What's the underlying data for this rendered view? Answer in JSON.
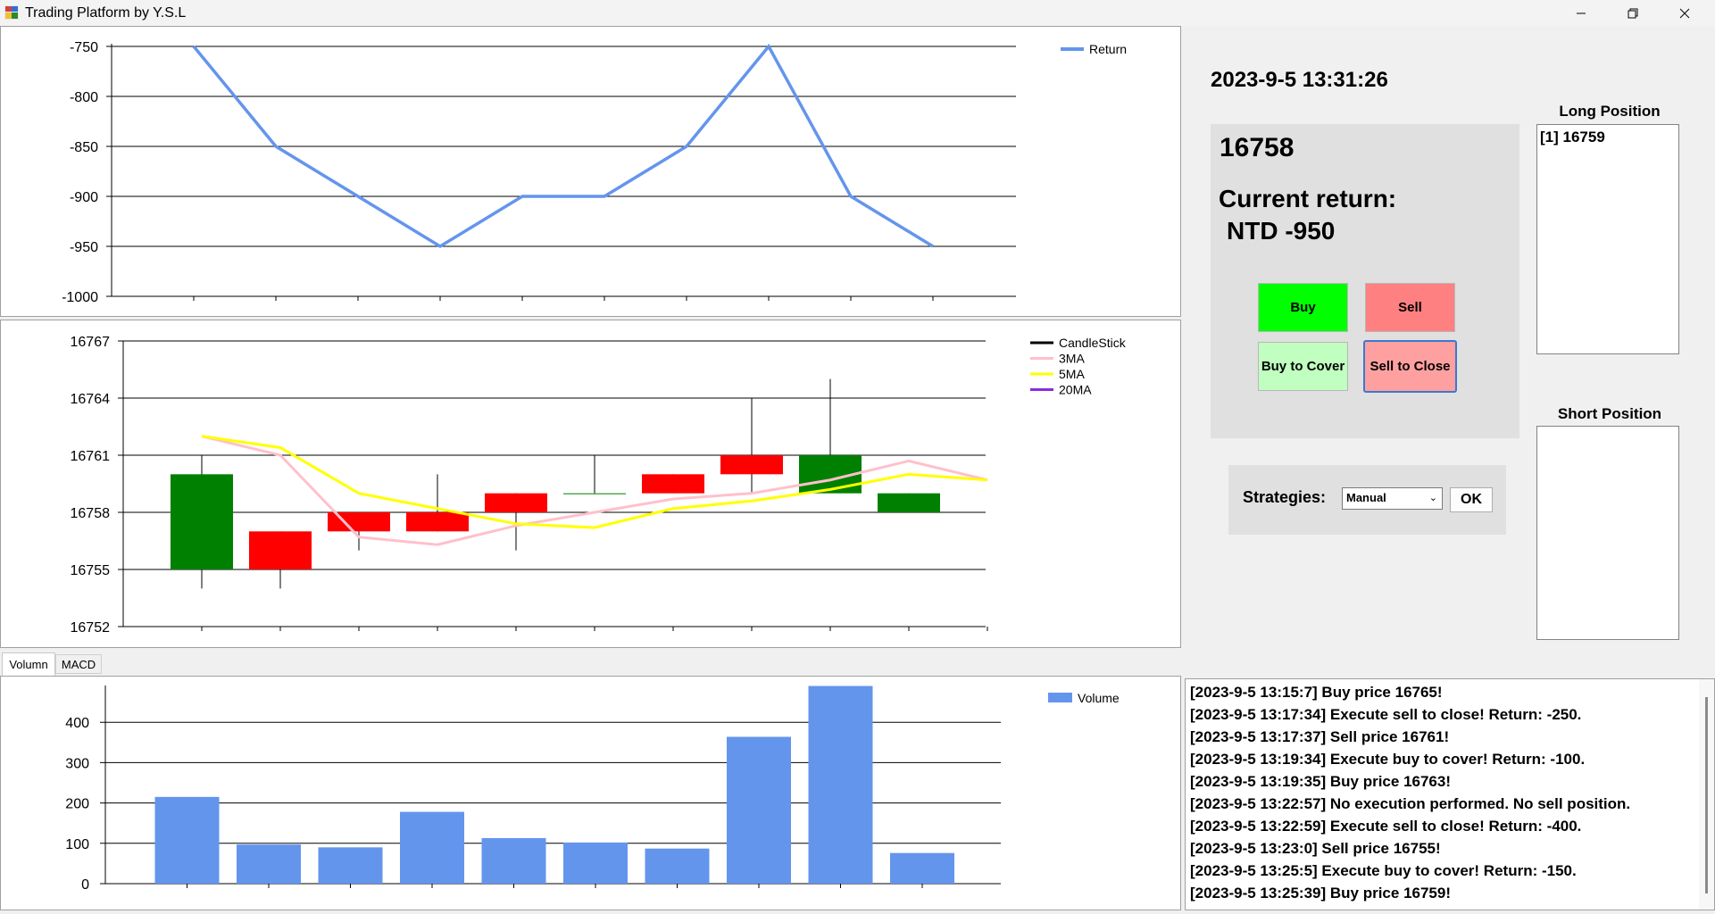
{
  "window": {
    "title": "Trading Platform by Y.S.L",
    "minimize_symbol": "—",
    "restore_symbol": "❐",
    "close_symbol": "✕"
  },
  "return_chart": {
    "legend": "Return",
    "y_ticks": [
      "-750",
      "-800",
      "-850",
      "-900",
      "-950",
      "-1000"
    ]
  },
  "candle_chart": {
    "legend": [
      "CandleStick",
      "3MA",
      "5MA",
      "20MA"
    ],
    "y_ticks": [
      "16767",
      "16764",
      "16761",
      "16758",
      "16755",
      "16752"
    ]
  },
  "bottom_tabs": [
    "Volumn",
    "MACD"
  ],
  "volume_chart": {
    "legend": "Volume",
    "y_ticks": [
      "400",
      "300",
      "200",
      "100",
      "0"
    ]
  },
  "chart_data": [
    {
      "type": "line",
      "title": "",
      "x": [
        1,
        2,
        3,
        4,
        5,
        6,
        7,
        8,
        9,
        10
      ],
      "series": [
        {
          "name": "Return",
          "values": [
            -750,
            -850,
            -900,
            -950,
            -900,
            -900,
            -850,
            -750,
            -900,
            -950
          ],
          "color": "#6495ed"
        }
      ],
      "ylim": [
        -1000,
        -750
      ],
      "grid": true,
      "legend_position": "top-right"
    },
    {
      "type": "candlestick",
      "title": "",
      "x": [
        1,
        2,
        3,
        4,
        5,
        6,
        7,
        8,
        9,
        10,
        11
      ],
      "candles": [
        {
          "open": 16755,
          "close": 16760,
          "high": 16761,
          "low": 16754
        },
        {
          "open": 16757,
          "close": 16755,
          "high": 16757,
          "low": 16754
        },
        {
          "open": 16758,
          "close": 16757,
          "high": 16758,
          "low": 16756
        },
        {
          "open": 16758,
          "close": 16757,
          "high": 16760,
          "low": 16757
        },
        {
          "open": 16759,
          "close": 16758,
          "high": 16759,
          "low": 16756
        },
        {
          "open": 16759,
          "close": 16759,
          "high": 16761,
          "low": 16759
        },
        {
          "open": 16760,
          "close": 16759,
          "high": 16760,
          "low": 16759
        },
        {
          "open": 16761,
          "close": 16760,
          "high": 16764,
          "low": 16759
        },
        {
          "open": 16759,
          "close": 16761,
          "high": 16765,
          "low": 16759
        },
        {
          "open": 16758,
          "close": 16759,
          "high": 16759,
          "low": 16758
        }
      ],
      "series": [
        {
          "name": "3MA",
          "values": [
            16762,
            16761,
            16756.7,
            16756.3,
            16757.3,
            16758,
            16758.7,
            16759,
            16759.7,
            16760.7,
            16759.7
          ],
          "color": "#ffc0cb"
        },
        {
          "name": "5MA",
          "values": [
            16762,
            16761.4,
            16759,
            16758.2,
            16757.4,
            16757.2,
            16758.2,
            16758.6,
            16759.2,
            16760,
            16759.7
          ],
          "color": "#ffff00"
        },
        {
          "name": "20MA",
          "values": [],
          "color": "#8a2be2"
        }
      ],
      "ylim": [
        16752,
        16767
      ],
      "grid": true,
      "legend_position": "top-right"
    },
    {
      "type": "bar",
      "title": "",
      "categories": [
        "1",
        "2",
        "3",
        "4",
        "5",
        "6",
        "7",
        "8",
        "9",
        "10"
      ],
      "series": [
        {
          "name": "Volume",
          "values": [
            215,
            97,
            90,
            178,
            113,
            102,
            87,
            364,
            490,
            76
          ],
          "color": "#6495ed"
        }
      ],
      "ylim": [
        0,
        490
      ],
      "grid": true,
      "legend_position": "top-right"
    }
  ],
  "clock": "2023-9-5 13:31:26",
  "info": {
    "price": "16758",
    "return_label": "Current return:",
    "return_value": "NTD -950"
  },
  "buttons": {
    "buy": "Buy",
    "sell": "Sell",
    "buy_to_cover": "Buy to Cover",
    "sell_to_close": "Sell to Close"
  },
  "strategies": {
    "label": "Strategies:",
    "selected": "Manual",
    "ok": "OK"
  },
  "positions": {
    "long_label": "Long Position",
    "long_items": [
      "[1] 16759"
    ],
    "short_label": "Short Position",
    "short_items": []
  },
  "log": [
    "[2023-9-5 13:15:7] Buy price 16765!",
    "[2023-9-5 13:17:34] Execute sell to close! Return: -250.",
    "[2023-9-5 13:17:37] Sell price 16761!",
    "[2023-9-5 13:19:34] Execute buy to cover! Return: -100.",
    "[2023-9-5 13:19:35] Buy price 16763!",
    "[2023-9-5 13:22:57] No execution performed. No sell position.",
    "[2023-9-5 13:22:59] Execute sell to close! Return: -400.",
    "[2023-9-5 13:23:0] Sell price 16755!",
    "[2023-9-5 13:25:5] Execute buy to cover! Return: -150.",
    "[2023-9-5 13:25:39] Buy price 16759!"
  ]
}
